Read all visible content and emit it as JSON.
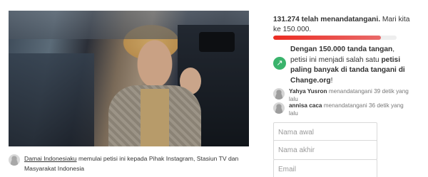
{
  "photo": {
    "alt_icon": "petition-photo"
  },
  "starter": {
    "name": "Damai Indonesiaku",
    "text": "memulai petisi ini kepada Pihak Instagram, Stasiun TV dan Masyarakat Indonesia"
  },
  "stats": {
    "count_bold": "131.274 telah menandatangani.",
    "goal_text": "Mari kita ke 150.000.",
    "progress_fraction": 0.875,
    "progress_color": "#ec2c22"
  },
  "milestone": {
    "bold_1": "Dengan 150.000 tanda tangan",
    "text_1": ", petisi ini menjadi salah satu",
    "bold_2": "petisi paling banyak di tanda tangani di Change.org",
    "text_2": "!",
    "icon": "trending-up-icon",
    "icon_color": "#3ab36c"
  },
  "signers": [
    {
      "name": "Yahya Yusron",
      "text": "menandatangani 39 detik yang lalu"
    },
    {
      "name": "annisa caca",
      "text": "menandatangani 36 detik yang lalu"
    }
  ],
  "form": {
    "first_name_placeholder": "Nama awal",
    "last_name_placeholder": "Nama akhir",
    "email_placeholder": "Email"
  }
}
